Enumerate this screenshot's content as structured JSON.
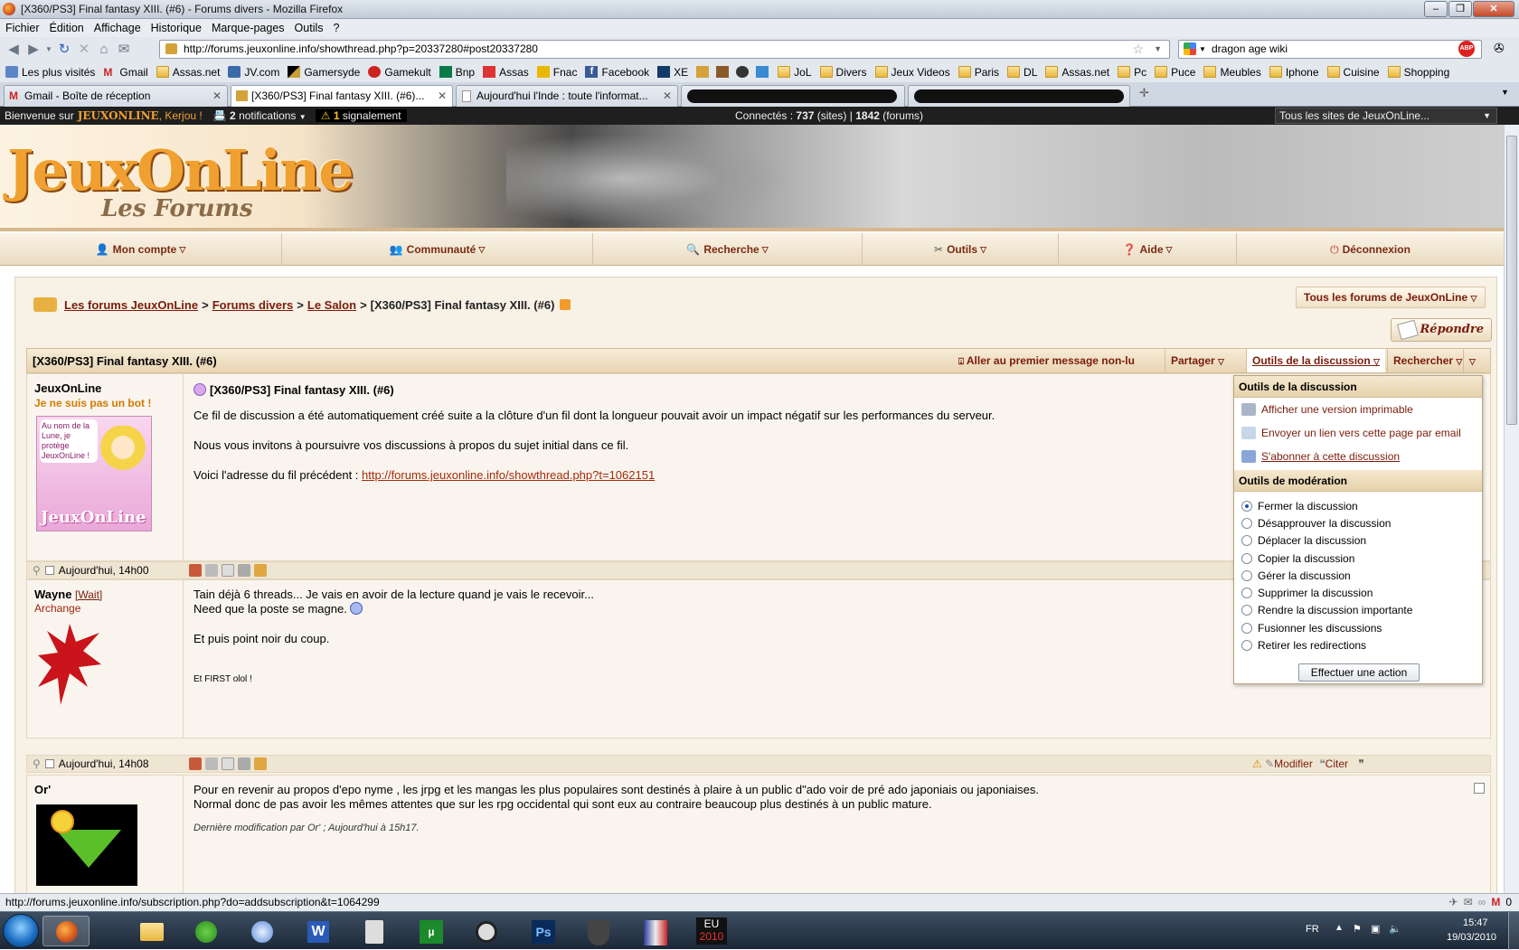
{
  "window": {
    "title": "[X360/PS3] Final fantasy XIII. (#6) - Forums divers - Mozilla Firefox"
  },
  "menu": [
    "Fichier",
    "Édition",
    "Affichage",
    "Historique",
    "Marque-pages",
    "Outils",
    "?"
  ],
  "nav": {
    "url": "http://forums.jeuxonline.info/showthread.php?p=20337280#post20337280",
    "search_value": "dragon age wiki"
  },
  "bookmarks": [
    "Les plus visités",
    "Gmail",
    "Assas.net",
    "JV.com",
    "Gamersyde",
    "Gamekult",
    "Bnp",
    "Assas",
    "Fnac",
    "Facebook",
    "XE",
    "JoL",
    "Divers",
    "Jeux Videos",
    "Paris",
    "DL",
    "Assas.net",
    "Pc",
    "Puce",
    "Meubles",
    "Iphone",
    "Cuisine",
    "Shopping"
  ],
  "tabs": [
    {
      "label": "Gmail - Boîte de réception"
    },
    {
      "label": "[X360/PS3] Final fantasy XIII. (#6)..."
    },
    {
      "label": "Aujourd'hui l'Inde : toute l'informat..."
    }
  ],
  "jolbar": {
    "welcome": "Bienvenue sur",
    "site": "JEUXONLINE",
    "user": ", Kerjou !",
    "notif_count": "2",
    "notif_label": "notifications",
    "alert_count": "1",
    "alert_label": "signalement",
    "connected": "Connectés :",
    "sites_count": "737",
    "sites_label": "(sites) |",
    "forums_count": "1842",
    "forums_label": "(forums)",
    "sites_select": "Tous les sites de JeuxOnLine..."
  },
  "banner": {
    "logo": "JeuxOnLine",
    "subtitle": "Les Forums"
  },
  "mainnav": [
    "Mon compte",
    "Communauté",
    "Recherche",
    "Outils",
    "Aide",
    "Déconnexion"
  ],
  "breadcrumb": {
    "root": "Les forums JeuxOnLine",
    "c1": "Forums divers",
    "c2": "Le Salon",
    "current": "[X360/PS3] Final fantasy XIII. (#6)",
    "forums_select": "Tous les forums de JeuxOnLine"
  },
  "reply_label": "Répondre",
  "thread": {
    "title": "[X360/PS3] Final fantasy XIII. (#6)",
    "first_unread": "Aller au premier message non-lu",
    "share": "Partager",
    "tools": "Outils de la discussion",
    "search": "Rechercher"
  },
  "posts": [
    {
      "author": "JeuxOnLine",
      "title": "Je ne suis pas un bot !",
      "avatar_text": "Au nom de la Lune, je protège JeuxOnLine !",
      "subject": "[X360/PS3] Final fantasy XIII. (#6)",
      "p1": "Ce fil de discussion a été automatiquement créé suite a la clôture d'un fil dont la longueur pouvait avoir un impact négatif sur les performances du serveur.",
      "p2": "Nous vous invitons à poursuivre vos discussions à propos du sujet initial dans ce fil.",
      "p3_prefix": "Voici l'adresse du fil précédent :",
      "link": "http://forums.jeuxonline.info/showthread.php?t=1062151",
      "time": "Aujourd'hui, 14h00"
    },
    {
      "author": "Wayne",
      "status": "[Wait]",
      "title": "Archange",
      "l1": "Tain déjà 6 threads... Je vais en avoir de la lecture quand je vais le recevoir...",
      "l2": "Need que la poste se magne.",
      "l3": "Et puis point noir du coup.",
      "l4": "Et FIRST olol !",
      "time": "Aujourd'hui, 14h08",
      "edit": "Modifier",
      "quote": "Citer"
    },
    {
      "author": "Or'",
      "l1": "Pour en revenir au propos d'epo nyme , les jrpg et les mangas les plus populaires sont destinés à plaire à un public d\"ado voir de pré ado japoniais ou japoniaises.",
      "l2": "Normal donc de pas avoir les mêmes attentes que sur les rpg occidental qui sont eux au contraire beaucoup plus destinés à un public mature.",
      "edited": "Dernière modification par Or' ; Aujourd'hui à 15h17."
    }
  ],
  "dropdown": {
    "h1": "Outils de la discussion",
    "links": [
      "Afficher une version imprimable",
      "Envoyer un lien vers cette page par email",
      "S'abonner à cette discussion"
    ],
    "h2": "Outils de modération",
    "radios": [
      "Fermer la discussion",
      "Désapprouver la discussion",
      "Déplacer la discussion",
      "Copier la discussion",
      "Gérer la discussion",
      "Supprimer la discussion",
      "Rendre la discussion importante",
      "Fusionner les discussions",
      "Retirer les redirections"
    ],
    "selected": "Fermer la discussion",
    "action": "Effectuer une action"
  },
  "status": "http://forums.jeuxonline.info/subscription.php?do=addsubscription&t=1064299",
  "taskbar": {
    "lang": "FR",
    "time": "15:47",
    "date": "19/03/2010",
    "eu": "EU",
    "eu_year": "2010",
    "ps": "Ps"
  },
  "tray": {
    "count": "0"
  }
}
